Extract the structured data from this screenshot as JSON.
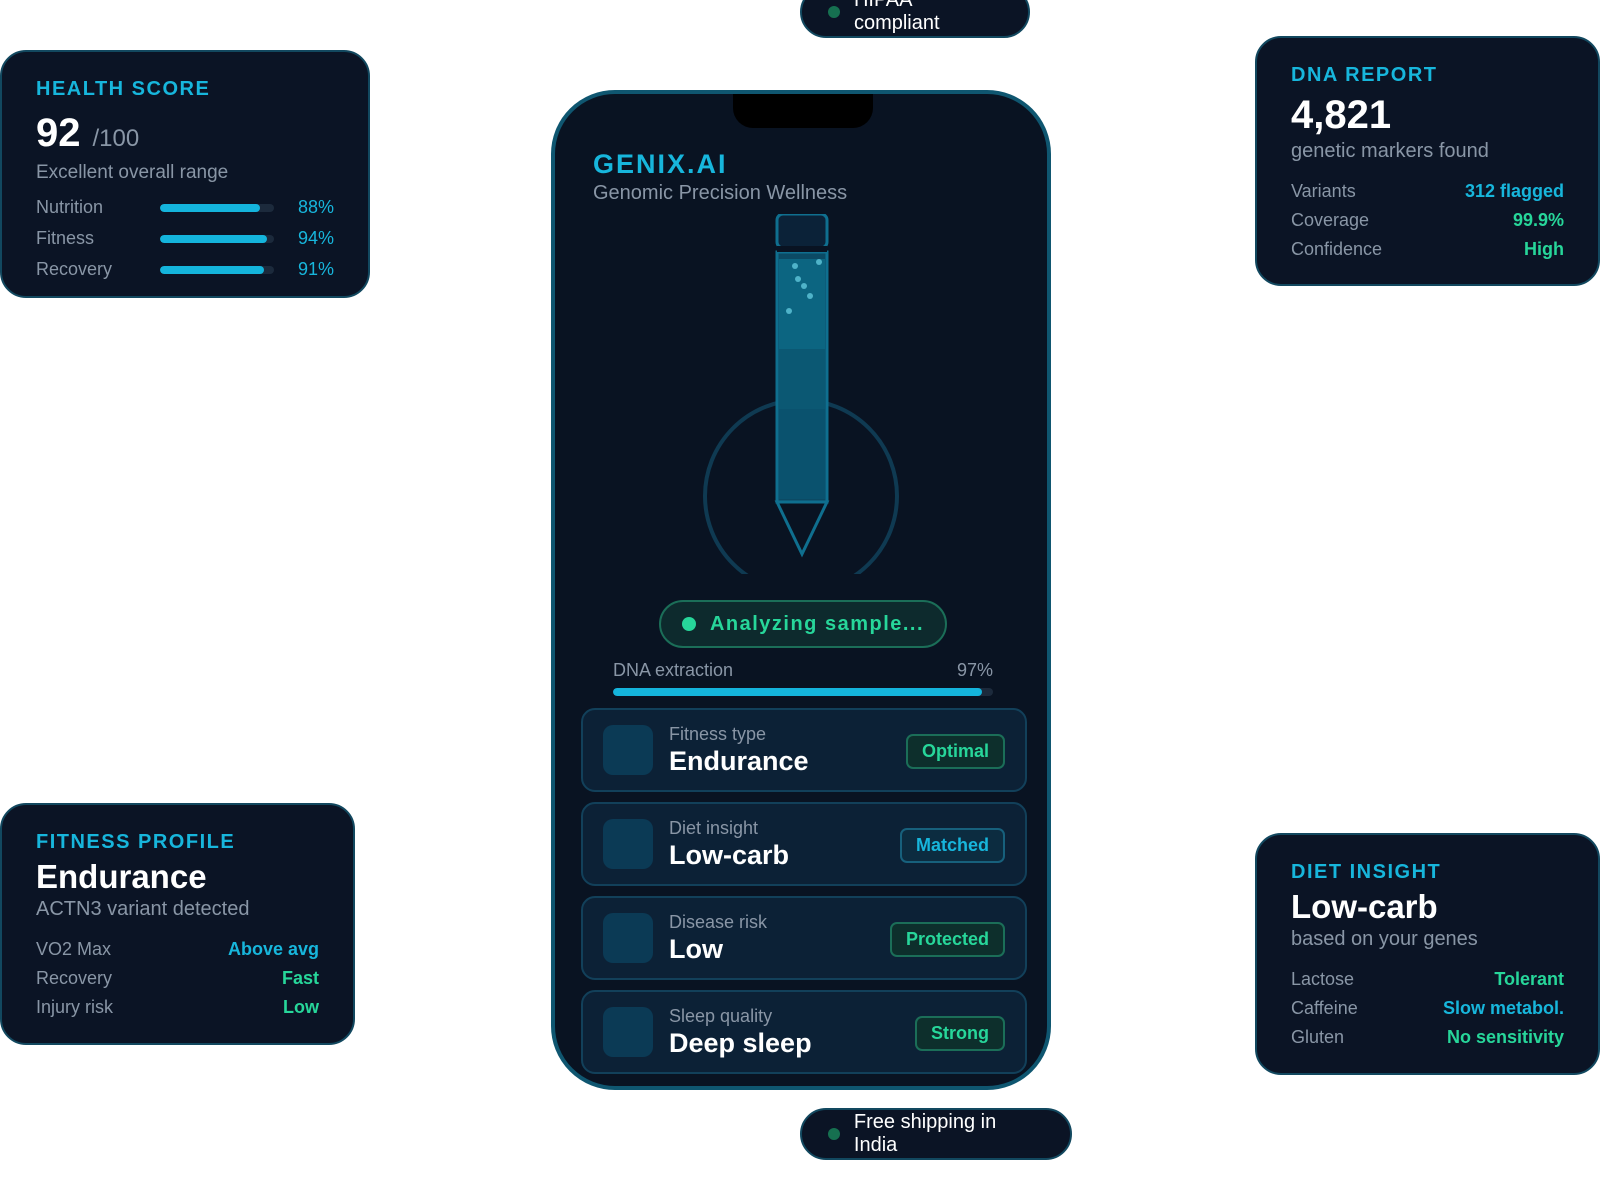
{
  "health_card": {
    "title": "HEALTH SCORE",
    "score": "92",
    "out_of": "/100",
    "subtitle": "Excellent overall range",
    "metrics": [
      {
        "label": "Nutrition",
        "value": "88%",
        "fraction": 0.88
      },
      {
        "label": "Fitness",
        "value": "94%",
        "fraction": 0.94
      },
      {
        "label": "Recovery",
        "value": "91%",
        "fraction": 0.91
      }
    ]
  },
  "dna_card": {
    "title": "DNA REPORT",
    "value": "4,821",
    "subtitle": "genetic markers found",
    "rows": [
      {
        "key": "Variants",
        "value": "312 flagged",
        "tone": "cyan"
      },
      {
        "key": "Coverage",
        "value": "99.9%",
        "tone": "green"
      },
      {
        "key": "Confidence",
        "value": "High",
        "tone": "green"
      }
    ]
  },
  "fitness_card": {
    "title": "FITNESS PROFILE",
    "value": "Endurance",
    "subtitle": "ACTN3 variant detected",
    "rows": [
      {
        "key": "VO2 Max",
        "value": "Above avg",
        "tone": "cyan"
      },
      {
        "key": "Recovery",
        "value": "Fast",
        "tone": "green"
      },
      {
        "key": "Injury risk",
        "value": "Low",
        "tone": "green"
      }
    ]
  },
  "diet_card": {
    "title": "DIET INSIGHT",
    "value": "Low-carb",
    "subtitle": "based on your genes",
    "rows": [
      {
        "key": "Lactose",
        "value": "Tolerant",
        "tone": "green"
      },
      {
        "key": "Caffeine",
        "value": "Slow metabol.",
        "tone": "cyan"
      },
      {
        "key": "Gluten",
        "value": "No sensitivity",
        "tone": "green"
      }
    ]
  },
  "pills": {
    "top": "HIPAA compliant",
    "bottom": "Free shipping in India"
  },
  "phone": {
    "brand": "GENIX.AI",
    "tagline": "Genomic Precision Wellness",
    "status": "Analyzing sample...",
    "progress_label": "DNA extraction",
    "progress_value": "97%",
    "progress_fraction": 0.97,
    "insights": [
      {
        "label": "Fitness type",
        "value": "Endurance",
        "badge": "Optimal",
        "tone": "g"
      },
      {
        "label": "Diet insight",
        "value": "Low-carb",
        "badge": "Matched",
        "tone": "c"
      },
      {
        "label": "Disease risk",
        "value": "Low",
        "badge": "Protected",
        "tone": "g"
      },
      {
        "label": "Sleep quality",
        "value": "Deep sleep",
        "badge": "Strong",
        "tone": "g"
      }
    ]
  },
  "colors": {
    "accent_cyan": "#17b6dc",
    "accent_green": "#27d69a",
    "card_bg": "#0b1425",
    "border": "#12485f"
  }
}
